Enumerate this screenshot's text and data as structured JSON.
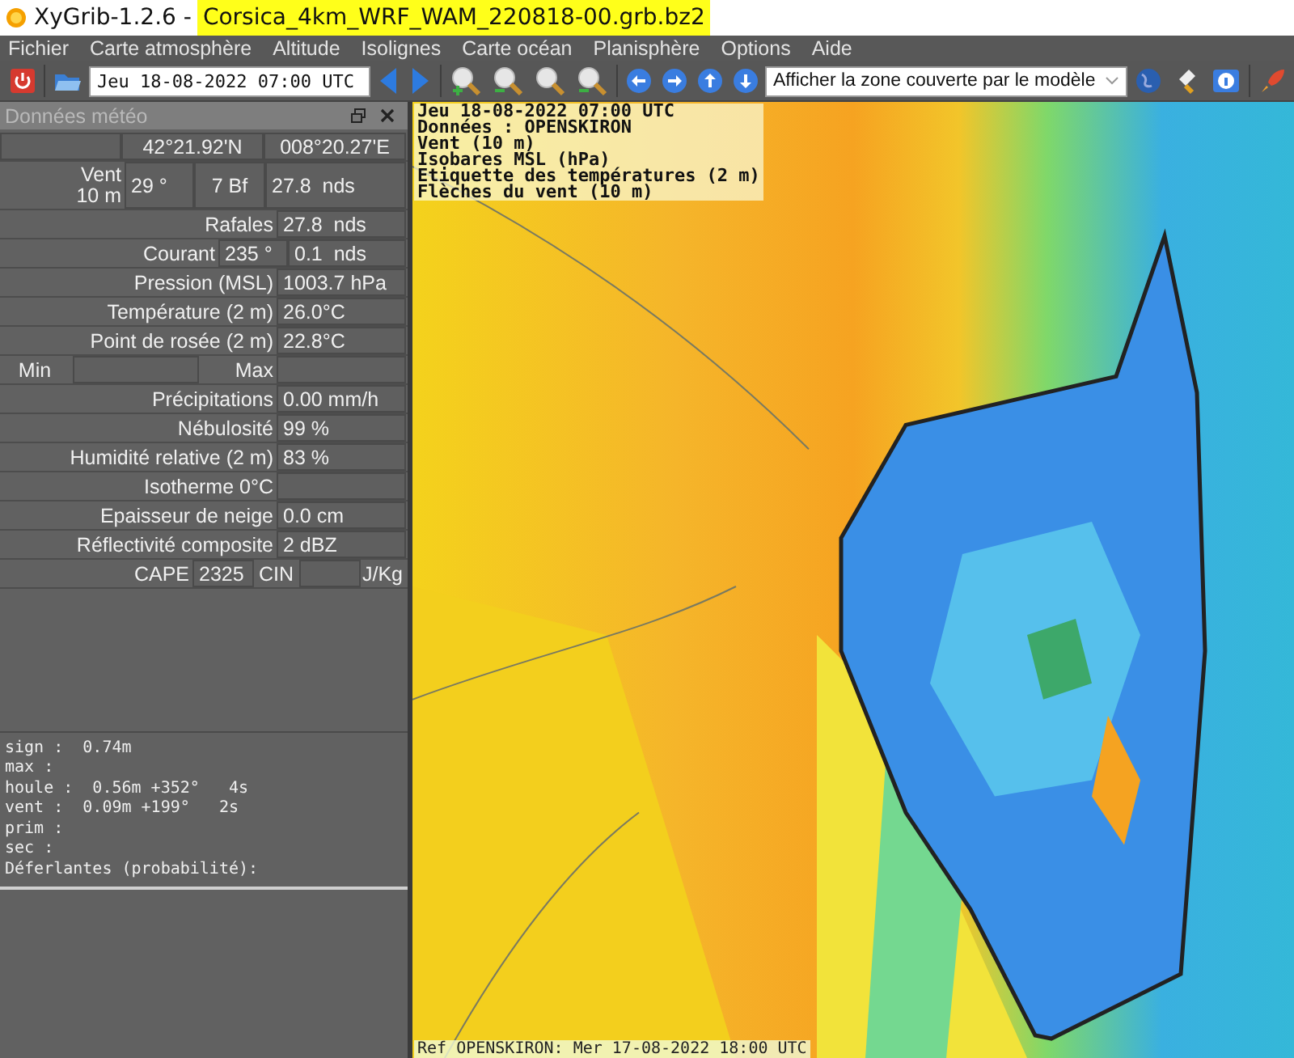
{
  "window": {
    "app_title": "XyGrib-1.2.6 -",
    "file_name": "Corsica_4km_WRF_WAM_220818-00.grb.bz2"
  },
  "menu": [
    "Fichier",
    "Carte atmosphère",
    "Altitude",
    "Isolignes",
    "Carte océan",
    "Planisphère",
    "Options",
    "Aide"
  ],
  "toolbar": {
    "date": "Jeu 18-08-2022 07:00 UTC",
    "zone": "Afficher la zone couverte par le modèle"
  },
  "panel": {
    "title": "Données météo",
    "rows": [
      {
        "kind": "coords",
        "values": [
          "42°21.92'N",
          "008°20.27'E"
        ]
      },
      {
        "kind": "wind",
        "label": [
          "Vent",
          "10 m"
        ],
        "values": [
          "29 °",
          "7 Bf",
          "27.8  nds"
        ]
      },
      {
        "kind": "field",
        "label": "Rafales",
        "values": [
          "27.8  nds"
        ]
      },
      {
        "kind": "split",
        "label": "Courant",
        "values": [
          "235 °",
          "0.1  nds"
        ]
      },
      {
        "kind": "field",
        "label": "Pression (MSL)",
        "values": [
          "1003.7 hPa"
        ]
      },
      {
        "kind": "field",
        "label": "Température (2 m)",
        "values": [
          "26.0°C"
        ]
      },
      {
        "kind": "field",
        "label": "Point de rosée (2 m)",
        "values": [
          "22.8°C"
        ]
      },
      {
        "kind": "minmax",
        "labels": [
          "Min",
          "Max"
        ]
      },
      {
        "kind": "field",
        "label": "Précipitations",
        "values": [
          "0.00 mm/h"
        ]
      },
      {
        "kind": "field",
        "label": "Nébulosité",
        "values": [
          "99 %"
        ]
      },
      {
        "kind": "field",
        "label": "Humidité relative (2 m)",
        "values": [
          "83 %"
        ]
      },
      {
        "kind": "field",
        "label": "Isotherme 0°C",
        "values": []
      },
      {
        "kind": "field",
        "label": "Epaisseur de neige",
        "values": [
          "0.0 cm"
        ]
      },
      {
        "kind": "field",
        "label": "Réflectivité composite",
        "values": [
          "2 dBZ"
        ]
      },
      {
        "kind": "cape",
        "labels": [
          "CAPE",
          "CIN",
          "J/Kg"
        ],
        "values": [
          "2325"
        ]
      }
    ],
    "details": [
      "sign :  0.74m",
      "max :",
      "houle :  0.56m +352°   4s",
      "vent :  0.09m +199°   2s",
      "prim :",
      "sec :",
      "Déferlantes (probabilité):"
    ]
  },
  "map": {
    "legend": [
      "Jeu 18-08-2022 07:00 UTC",
      "Données : OPENSKIRON",
      "Vent (10 m)",
      "Isobares MSL (hPa)",
      "Etiquette des températures (2 m)",
      "Flèches du vent (10 m)"
    ],
    "footer": "Ref OPENSKIRON: Mer 17-08-2022 18:00 UTC"
  }
}
